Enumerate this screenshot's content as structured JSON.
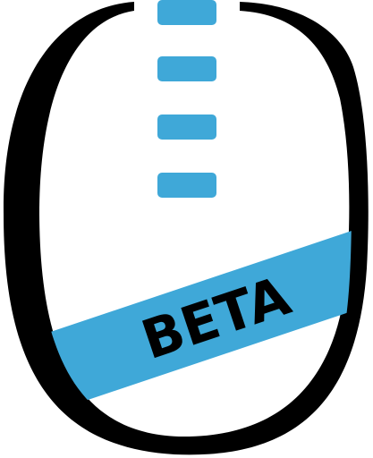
{
  "logo": {
    "badge_text": "BETA",
    "colors": {
      "outline": "#000000",
      "accent": "#3fa8d8",
      "background": "#ffffff",
      "badge_text": "#000000"
    },
    "icon_names": [
      "mouse-outline-icon",
      "scroll-wheel-dash-icon",
      "beta-ribbon"
    ]
  }
}
